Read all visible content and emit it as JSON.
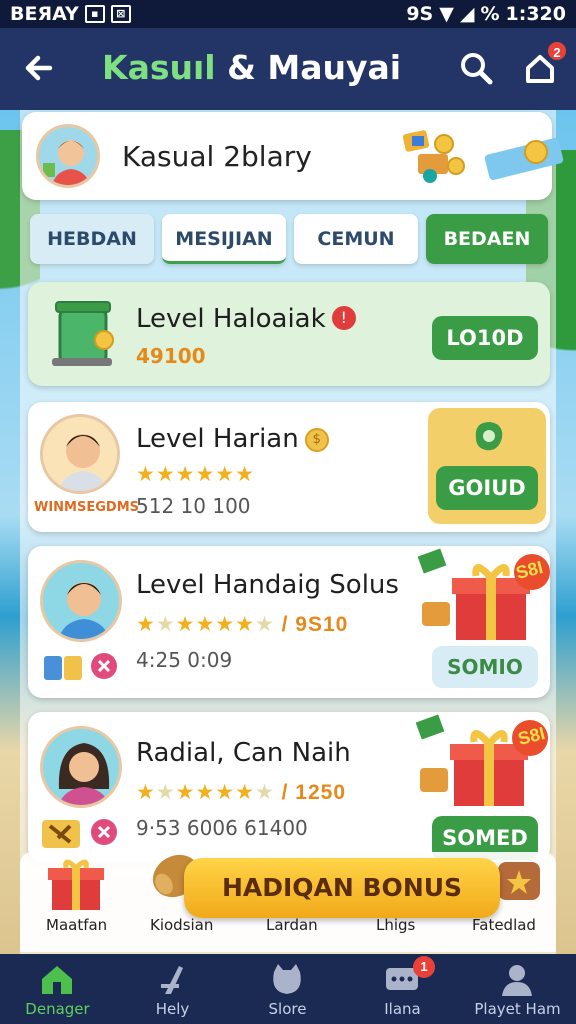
{
  "status_bar": {
    "left_text": "BEЯAY",
    "right_text": "9S",
    "battery_text": "%",
    "time": "1:320"
  },
  "header": {
    "title_accent": "Kasuıl",
    "title_rest": " & Mauyai",
    "notification_count": "2"
  },
  "profile": {
    "name": "Kasual 2blary"
  },
  "tabs": [
    {
      "label": "HEBDAN"
    },
    {
      "label": "MESIJIAN"
    },
    {
      "label": "CEMUN"
    },
    {
      "label": "BEDAEN"
    }
  ],
  "levels": [
    {
      "title": "Level Haloaiak",
      "sub": "49100",
      "button": "LO10D",
      "badge_symbol": "!"
    },
    {
      "title": "Level Harian",
      "sub": "512 10 100",
      "button": "GOIUD",
      "extra_label": "WINMSEGDMS",
      "rating_stars": 5
    },
    {
      "title": "Level Handaig Solus",
      "stars_suffix": "/ 9S10",
      "sub": "4:25 0:09",
      "button": "SOMIO",
      "gift_tag": "S8I",
      "rating_stars": 6
    },
    {
      "title": "Radial, Can Naih",
      "stars_suffix": "/ 1250",
      "sub": "9·53 6006 61400",
      "button": "SOMED",
      "gift_tag": "S8I",
      "rating_stars": 6
    }
  ],
  "dock": {
    "bonus_label": "HADIQAN BONUS",
    "items": [
      {
        "label": "Maatfan"
      },
      {
        "label": "Kiodsian"
      },
      {
        "label": "Lardan"
      },
      {
        "label": "Lhigs"
      },
      {
        "label": "Fatedlad"
      }
    ]
  },
  "bottom_nav": {
    "items": [
      {
        "label": "Denager"
      },
      {
        "label": "Hely"
      },
      {
        "label": "Slore"
      },
      {
        "label": "Ilana",
        "badge": "1"
      },
      {
        "label": "Playet Ham"
      }
    ]
  },
  "colors": {
    "header_bg": "#233566",
    "accent_green": "#3a9d45",
    "title_green": "#7ee081",
    "star_gold": "#f2b01e",
    "badge_red": "#e8413a",
    "bonus_yellow": "#ffd447"
  }
}
